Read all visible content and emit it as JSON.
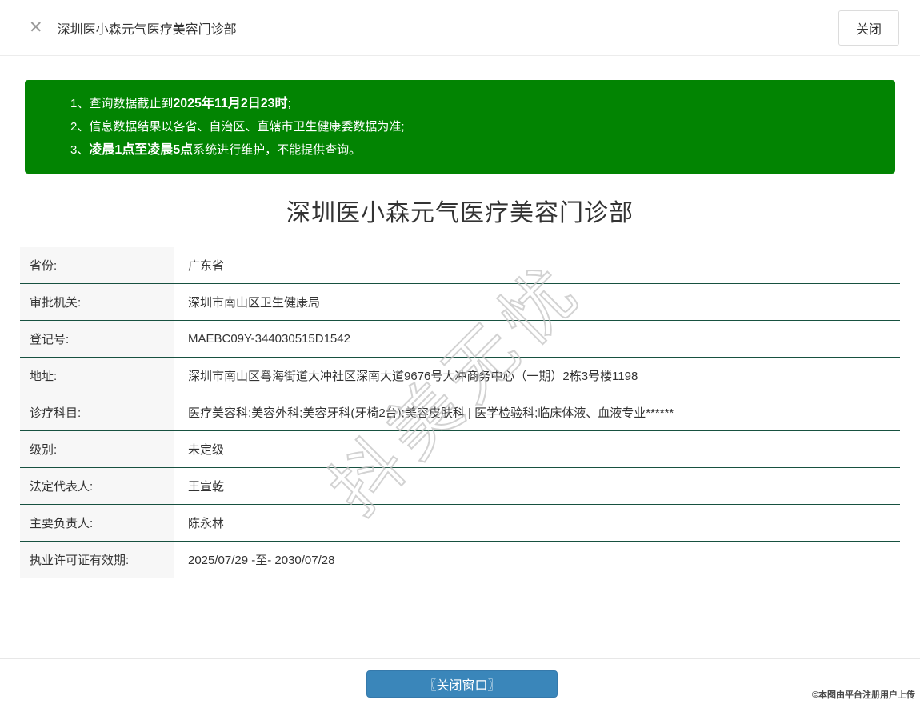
{
  "header": {
    "close_icon": "✕",
    "title": "深圳医小森元气医疗美容门诊部",
    "close_button_label": "关闭"
  },
  "notice": {
    "bg_color": "#028402",
    "text_color": "#ffffff",
    "lines": [
      {
        "prefix": "1、查询数据截止到",
        "bold": "2025年11月2日23时",
        "suffix": ";"
      },
      {
        "prefix": "2、信息数据结果以各省、自治区、直辖市卫生健康委数据为准;",
        "bold": "",
        "suffix": ""
      },
      {
        "prefix": "3、",
        "bold": "凌晨1点至凌晨5点",
        "suffix": "系统进行维护，不能提供查询。"
      }
    ]
  },
  "main": {
    "title": "深圳医小森元气医疗美容门诊部",
    "table": {
      "label_bg": "#f7f7f7",
      "divider_color": "#175140",
      "rows": [
        {
          "label": "省份:",
          "value": "广东省"
        },
        {
          "label": "审批机关:",
          "value": "深圳市南山区卫生健康局"
        },
        {
          "label": "登记号:",
          "value": "MAEBC09Y-344030515D1542"
        },
        {
          "label": "地址:",
          "value": "深圳市南山区粤海街道大冲社区深南大道9676号大冲商务中心（一期）2栋3号楼1198"
        },
        {
          "label": "诊疗科目:",
          "value": "医疗美容科;美容外科;美容牙科(牙椅2台);美容皮肤科 | 医学检验科;临床体液、血液专业******"
        },
        {
          "label": "级别:",
          "value": "未定级"
        },
        {
          "label": "法定代表人:",
          "value": "王宣乾"
        },
        {
          "label": "主要负责人:",
          "value": "陈永林"
        },
        {
          "label": "执业许可证有效期:",
          "value": "2025/07/29 -至- 2030/07/28"
        }
      ]
    },
    "watermark": "抖美无忧"
  },
  "footer": {
    "close_window_button": "〖关闭窗口〗",
    "button_color": "#3a86ba",
    "credit": "©本图由平台注册用户上传"
  }
}
